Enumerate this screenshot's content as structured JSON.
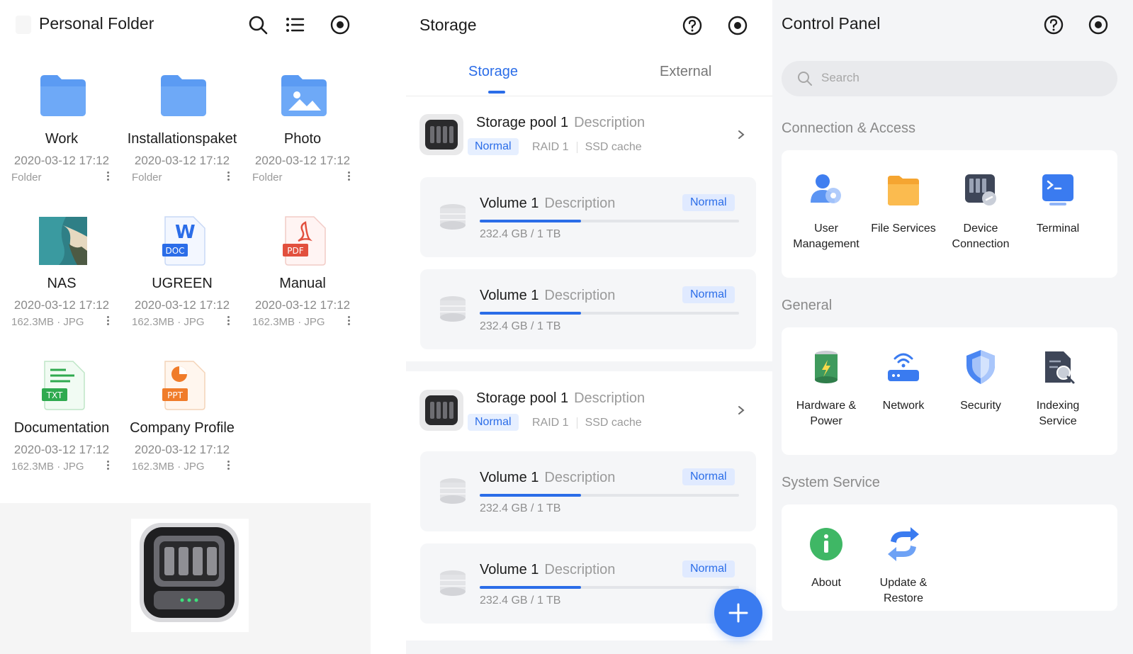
{
  "personal_folder": {
    "title": "Personal Folder",
    "icons": [
      "search-icon",
      "list-view-icon",
      "record-icon"
    ],
    "items": [
      {
        "name": "Work",
        "date": "2020-03-12 17:12",
        "meta": "Folder",
        "type": "folder"
      },
      {
        "name": "Installationspaket",
        "date": "2020-03-12 17:12",
        "meta": "Folder",
        "type": "folder"
      },
      {
        "name": "Photo",
        "date": "2020-03-12 17:12",
        "meta": "Folder",
        "type": "photo-folder"
      },
      {
        "name": "NAS",
        "date": "2020-03-12 17:12",
        "meta": "162.3MB · JPG",
        "type": "image"
      },
      {
        "name": "UGREEN",
        "date": "2020-03-12 17:12",
        "meta": "162.3MB · JPG",
        "type": "doc",
        "badge": "DOC",
        "letter": "W"
      },
      {
        "name": "Manual",
        "date": "2020-03-12 17:12",
        "meta": "162.3MB · JPG",
        "type": "pdf",
        "badge": "PDF"
      },
      {
        "name": "Documentation",
        "date": "2020-03-12 17:12",
        "meta": "162.3MB · JPG",
        "type": "txt",
        "badge": "TXT"
      },
      {
        "name": "Company Profile",
        "date": "2020-03-12 17:12",
        "meta": "162.3MB · JPG",
        "type": "ppt",
        "badge": "PPT"
      }
    ]
  },
  "storage": {
    "title": "Storage",
    "tabs": [
      {
        "label": "Storage",
        "active": true
      },
      {
        "label": "External",
        "active": false
      }
    ],
    "pools": [
      {
        "title": "Storage pool 1",
        "description": "Description",
        "status": "Normal",
        "raid": "RAID 1",
        "cache": "SSD cache",
        "volumes": [
          {
            "title": "Volume 1",
            "description": "Description",
            "status": "Normal",
            "size": "232.4 GB / 1 TB",
            "used_fraction": 0.39
          },
          {
            "title": "Volume 1",
            "description": "Description",
            "status": "Normal",
            "size": "232.4 GB / 1 TB",
            "used_fraction": 0.39
          }
        ]
      },
      {
        "title": "Storage pool 1",
        "description": "Description",
        "status": "Normal",
        "raid": "RAID 1",
        "cache": "SSD cache",
        "volumes": [
          {
            "title": "Volume 1",
            "description": "Description",
            "status": "Normal",
            "size": "232.4 GB / 1 TB",
            "used_fraction": 0.39
          },
          {
            "title": "Volume 1",
            "description": "Description",
            "status": "Normal",
            "size": "232.4 GB / 1 TB",
            "used_fraction": 0.39
          }
        ]
      }
    ],
    "fab_icon": "plus-icon"
  },
  "control_panel": {
    "title": "Control Panel",
    "search_placeholder": "Search",
    "sections": [
      {
        "title": "Connection & Access",
        "items": [
          {
            "label": "User Management",
            "icon": "user-management-icon"
          },
          {
            "label": "File Services",
            "icon": "folder-icon"
          },
          {
            "label": "Device Connection",
            "icon": "device-connection-icon"
          },
          {
            "label": "Terminal",
            "icon": "terminal-icon"
          }
        ]
      },
      {
        "title": "General",
        "items": [
          {
            "label": "Hardware & Power",
            "icon": "battery-icon"
          },
          {
            "label": "Network",
            "icon": "router-icon"
          },
          {
            "label": "Security",
            "icon": "shield-icon"
          },
          {
            "label": "Indexing Service",
            "icon": "indexing-icon"
          }
        ]
      },
      {
        "title": "System Service",
        "items": [
          {
            "label": "About",
            "icon": "info-icon"
          },
          {
            "label": "Update & Restore",
            "icon": "update-icon"
          }
        ]
      }
    ]
  },
  "colors": {
    "accent": "#2b6de8",
    "folder": "#5b9bf3",
    "background": "#f4f5f7"
  }
}
